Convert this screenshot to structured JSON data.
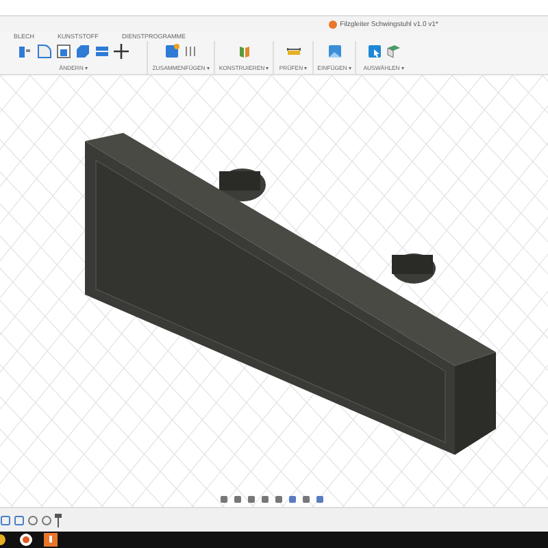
{
  "window": {
    "title": "Filzgleiter Schwingstuhl v1.0 v1*"
  },
  "tabs": [
    {
      "label": "BLECH"
    },
    {
      "label": "KUNSTSTOFF"
    },
    {
      "label": "DIENSTPROGRAMME"
    }
  ],
  "toolbar_groups": [
    {
      "label": "ÄNDERN",
      "caret": "▾"
    },
    {
      "label": "ZUSAMMENFÜGEN",
      "caret": "▾"
    },
    {
      "label": "KONSTRUIEREN",
      "caret": "▾"
    },
    {
      "label": "PRÜFEN",
      "caret": "▾"
    },
    {
      "label": "EINFÜGEN",
      "caret": "▾"
    },
    {
      "label": "AUSWÄHLEN",
      "caret": "▾"
    }
  ]
}
